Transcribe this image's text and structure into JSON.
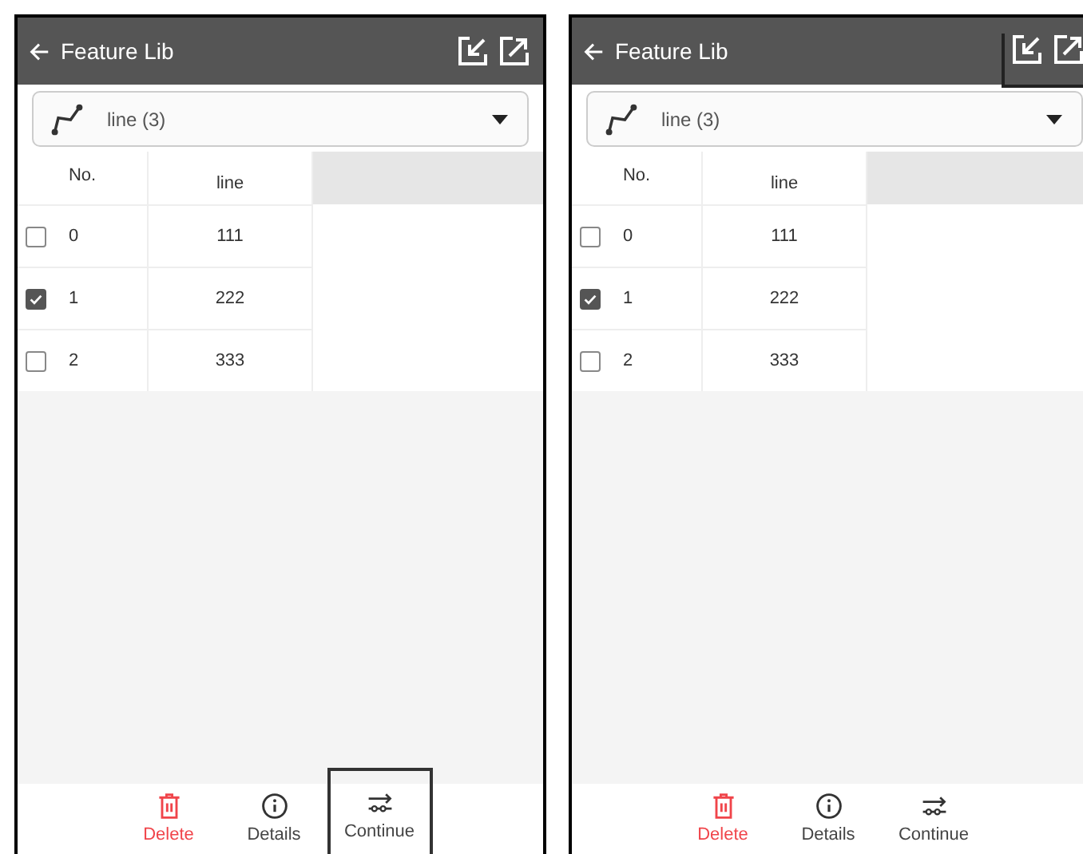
{
  "screens": [
    {
      "title": "Feature Lib",
      "header_icons_highlighted": false,
      "layer": {
        "label": "line (3)"
      },
      "table": {
        "columns": [
          "No.",
          "line"
        ],
        "rows": [
          {
            "no": "0",
            "value": "111",
            "checked": false
          },
          {
            "no": "1",
            "value": "222",
            "checked": true
          },
          {
            "no": "2",
            "value": "333",
            "checked": false
          }
        ]
      },
      "actions": [
        {
          "kind": "delete",
          "label": "Delete",
          "highlighted": false
        },
        {
          "kind": "details",
          "label": "Details",
          "highlighted": false
        },
        {
          "kind": "continue",
          "label": "Continue",
          "highlighted": true
        }
      ]
    },
    {
      "title": "Feature Lib",
      "header_icons_highlighted": true,
      "layer": {
        "label": "line (3)"
      },
      "table": {
        "columns": [
          "No.",
          "line"
        ],
        "rows": [
          {
            "no": "0",
            "value": "111",
            "checked": false
          },
          {
            "no": "1",
            "value": "222",
            "checked": true
          },
          {
            "no": "2",
            "value": "333",
            "checked": false
          }
        ]
      },
      "actions": [
        {
          "kind": "delete",
          "label": "Delete",
          "highlighted": false
        },
        {
          "kind": "details",
          "label": "Details",
          "highlighted": false
        },
        {
          "kind": "continue",
          "label": "Continue",
          "highlighted": false
        }
      ]
    }
  ]
}
